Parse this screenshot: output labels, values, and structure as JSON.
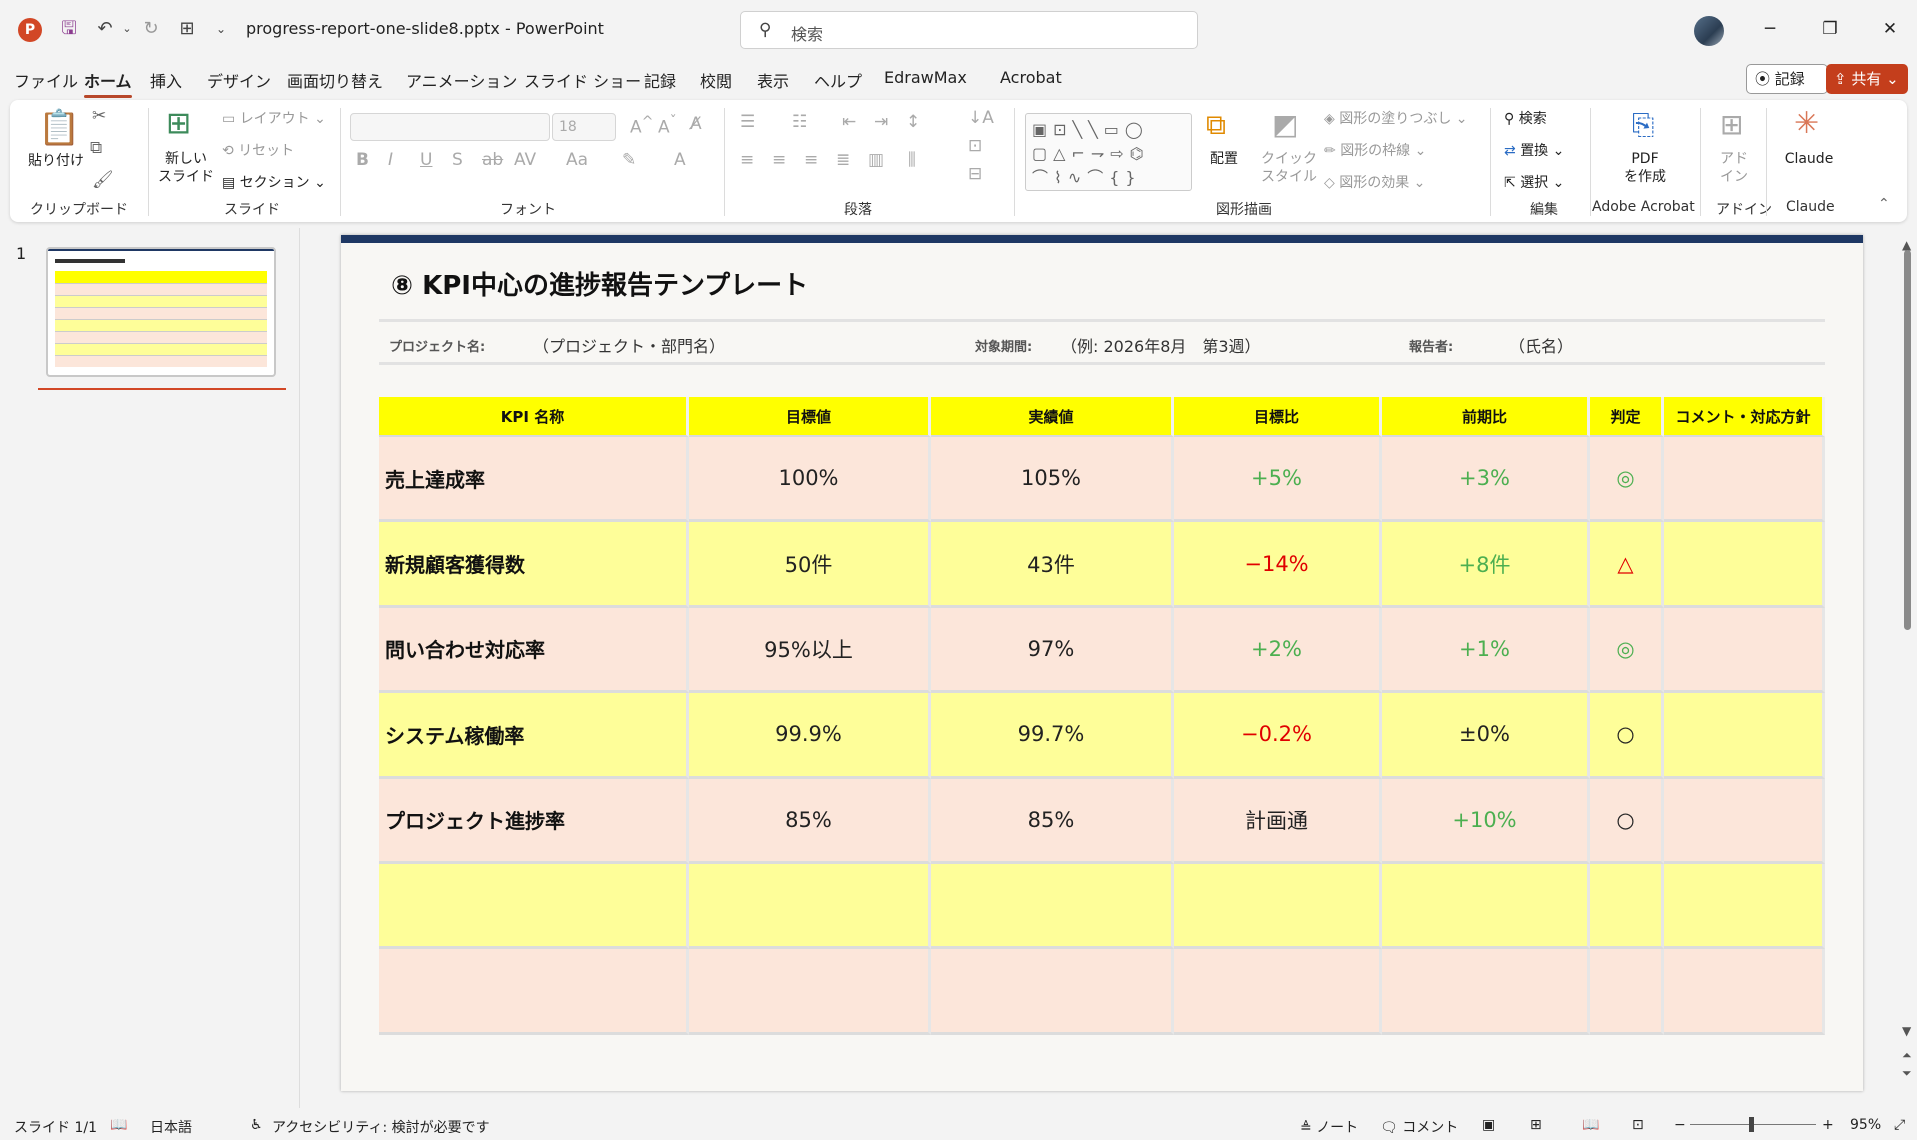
{
  "titlebar": {
    "app_logo": "P",
    "doc_title": "progress-report-one-slide8.pptx  -  PowerPoint",
    "search_placeholder": "検索",
    "minimize": "─",
    "restore": "❐",
    "close": "✕"
  },
  "menu": {
    "tabs": [
      "ファイル",
      "ホーム",
      "挿入",
      "デザイン",
      "画面切り替え",
      "アニメーション",
      "スライド ショー",
      "記録",
      "校閲",
      "表示",
      "ヘルプ",
      "EdrawMax",
      "Acrobat"
    ],
    "active": "ホーム",
    "record_label": "記録",
    "share_label": "共有"
  },
  "ribbon": {
    "groups": {
      "clipboard": "クリップボード",
      "slides": "スライド",
      "font": "フォント",
      "paragraph": "段落",
      "drawing": "図形描画",
      "editing": "編集",
      "adobe": "Adobe Acrobat",
      "addin": "アドイン",
      "claude": "Claude"
    },
    "paste_label": "貼り付け",
    "new_slide_label_1": "新しい",
    "new_slide_label_2": "スライド",
    "layout_label": "レイアウト",
    "reset_label": "リセット",
    "section_label": "セクション",
    "font_size": "18",
    "arrange_label": "配置",
    "quick_style_label_1": "クイック",
    "quick_style_label_2": "スタイル",
    "shape_fill_label": "図形の塗りつぶし",
    "shape_outline_label": "図形の枠線",
    "shape_effect_label": "図形の効果",
    "find_label": "検索",
    "replace_label": "置換",
    "select_label": "選択",
    "pdf_label_1": "PDF",
    "pdf_label_2": "を作成",
    "addin_label_1": "アド",
    "addin_label_2": "イン",
    "claude_label": "Claude"
  },
  "slide_panel": {
    "slide_number": "1"
  },
  "slide": {
    "title": "⑧ KPI中心の進捗報告テンプレート",
    "info": {
      "project_label": "プロジェクト名:",
      "project_value": "（プロジェクト・部門名）",
      "period_label": "対象期間:",
      "period_value": "（例: 2026年8月　第3週）",
      "reporter_label": "報告者:",
      "reporter_value": "（氏名）"
    },
    "table": {
      "headers": [
        "KPI 名称",
        "目標値",
        "実績値",
        "目標比",
        "前期比",
        "判定",
        "コメント・対応方針"
      ],
      "rows": [
        [
          "売上達成率",
          "100%",
          "105%",
          "+5%",
          "+3%",
          "◎",
          ""
        ],
        [
          "新規顧客獲得数",
          "50件",
          "43件",
          "−14%",
          "+8件",
          "△",
          ""
        ],
        [
          "問い合わせ対応率",
          "95%以上",
          "97%",
          "+2%",
          "+1%",
          "◎",
          ""
        ],
        [
          "システム稼働率",
          "99.9%",
          "99.7%",
          "−0.2%",
          "±0%",
          "○",
          ""
        ],
        [
          "プロジェクト進捗率",
          "85%",
          "85%",
          "計画通",
          "+10%",
          "○",
          ""
        ],
        [
          "",
          "",
          "",
          "",
          "",
          "",
          ""
        ],
        [
          "",
          "",
          "",
          "",
          "",
          "",
          ""
        ]
      ]
    }
  },
  "status": {
    "slide_info": "スライド 1/1",
    "language": "日本語",
    "accessibility": "アクセシビリティ: 検討が必要です",
    "notes": "ノート",
    "comments": "コメント",
    "zoom": "95%"
  },
  "colors": {
    "header_yellow": "#ffff00",
    "row_peach": "#fce6da",
    "row_yellow": "#fefe99",
    "positive": "#4caf50",
    "negative": "#e00000",
    "accent": "#b7472a",
    "share": "#c43e1c",
    "slide_topbar": "#1f3864"
  }
}
